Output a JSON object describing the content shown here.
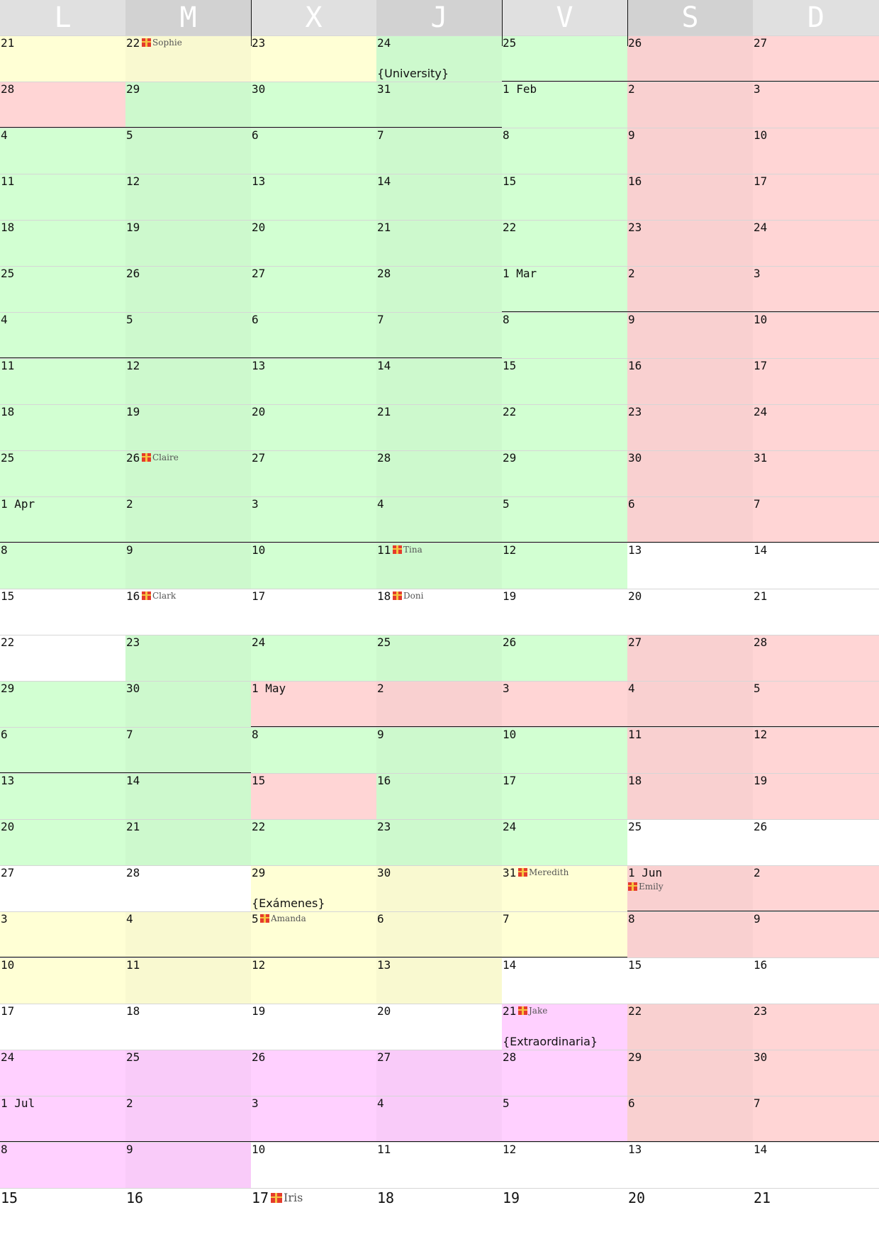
{
  "colors": {
    "header_a": "#e0e0e0",
    "header_b": "#d2d2d2",
    "yellow": "#ffffd5",
    "green": "#d2ffd2",
    "red": "#ffd5d5",
    "pink": "#ffd0ff",
    "white": "#ffffff",
    "rowline": "#d6d6d6",
    "monthline": "#111111"
  },
  "weekdays": [
    "L",
    "M",
    "X",
    "J",
    "V",
    "S",
    "D"
  ],
  "weeks": [
    {
      "days": [
        {
          "label": "21",
          "bg": "yellow"
        },
        {
          "label": "22",
          "bg": "yellow",
          "birthday": "Sophie"
        },
        {
          "label": "23",
          "bg": "yellow"
        },
        {
          "label": "24",
          "bg": "green",
          "event": "{University}"
        },
        {
          "label": "25",
          "bg": "green"
        },
        {
          "label": "26",
          "bg": "red"
        },
        {
          "label": "27",
          "bg": "red"
        }
      ]
    },
    {
      "days": [
        {
          "label": "28",
          "bg": "red"
        },
        {
          "label": "29",
          "bg": "green"
        },
        {
          "label": "30",
          "bg": "green"
        },
        {
          "label": "31",
          "bg": "green"
        },
        {
          "label": "1 Feb",
          "bg": "green"
        },
        {
          "label": "2",
          "bg": "red"
        },
        {
          "label": "3",
          "bg": "red"
        }
      ]
    },
    {
      "days": [
        {
          "label": "4",
          "bg": "green"
        },
        {
          "label": "5",
          "bg": "green"
        },
        {
          "label": "6",
          "bg": "green"
        },
        {
          "label": "7",
          "bg": "green"
        },
        {
          "label": "8",
          "bg": "green"
        },
        {
          "label": "9",
          "bg": "red"
        },
        {
          "label": "10",
          "bg": "red"
        }
      ]
    },
    {
      "days": [
        {
          "label": "11",
          "bg": "green"
        },
        {
          "label": "12",
          "bg": "green"
        },
        {
          "label": "13",
          "bg": "green"
        },
        {
          "label": "14",
          "bg": "green"
        },
        {
          "label": "15",
          "bg": "green"
        },
        {
          "label": "16",
          "bg": "red"
        },
        {
          "label": "17",
          "bg": "red"
        }
      ]
    },
    {
      "days": [
        {
          "label": "18",
          "bg": "green"
        },
        {
          "label": "19",
          "bg": "green"
        },
        {
          "label": "20",
          "bg": "green"
        },
        {
          "label": "21",
          "bg": "green"
        },
        {
          "label": "22",
          "bg": "green"
        },
        {
          "label": "23",
          "bg": "red"
        },
        {
          "label": "24",
          "bg": "red"
        }
      ]
    },
    {
      "days": [
        {
          "label": "25",
          "bg": "green"
        },
        {
          "label": "26",
          "bg": "green"
        },
        {
          "label": "27",
          "bg": "green"
        },
        {
          "label": "28",
          "bg": "green"
        },
        {
          "label": "1 Mar",
          "bg": "green"
        },
        {
          "label": "2",
          "bg": "red"
        },
        {
          "label": "3",
          "bg": "red"
        }
      ]
    },
    {
      "days": [
        {
          "label": "4",
          "bg": "green"
        },
        {
          "label": "5",
          "bg": "green"
        },
        {
          "label": "6",
          "bg": "green"
        },
        {
          "label": "7",
          "bg": "green"
        },
        {
          "label": "8",
          "bg": "green"
        },
        {
          "label": "9",
          "bg": "red"
        },
        {
          "label": "10",
          "bg": "red"
        }
      ]
    },
    {
      "days": [
        {
          "label": "11",
          "bg": "green"
        },
        {
          "label": "12",
          "bg": "green"
        },
        {
          "label": "13",
          "bg": "green"
        },
        {
          "label": "14",
          "bg": "green"
        },
        {
          "label": "15",
          "bg": "green"
        },
        {
          "label": "16",
          "bg": "red"
        },
        {
          "label": "17",
          "bg": "red"
        }
      ]
    },
    {
      "days": [
        {
          "label": "18",
          "bg": "green"
        },
        {
          "label": "19",
          "bg": "green"
        },
        {
          "label": "20",
          "bg": "green"
        },
        {
          "label": "21",
          "bg": "green"
        },
        {
          "label": "22",
          "bg": "green"
        },
        {
          "label": "23",
          "bg": "red"
        },
        {
          "label": "24",
          "bg": "red"
        }
      ]
    },
    {
      "days": [
        {
          "label": "25",
          "bg": "green"
        },
        {
          "label": "26",
          "bg": "green",
          "birthday": "Claire"
        },
        {
          "label": "27",
          "bg": "green"
        },
        {
          "label": "28",
          "bg": "green"
        },
        {
          "label": "29",
          "bg": "green"
        },
        {
          "label": "30",
          "bg": "red"
        },
        {
          "label": "31",
          "bg": "red"
        }
      ]
    },
    {
      "days": [
        {
          "label": "1 Apr",
          "bg": "green"
        },
        {
          "label": "2",
          "bg": "green"
        },
        {
          "label": "3",
          "bg": "green"
        },
        {
          "label": "4",
          "bg": "green"
        },
        {
          "label": "5",
          "bg": "green"
        },
        {
          "label": "6",
          "bg": "red"
        },
        {
          "label": "7",
          "bg": "red"
        }
      ]
    },
    {
      "days": [
        {
          "label": "8",
          "bg": "green"
        },
        {
          "label": "9",
          "bg": "green"
        },
        {
          "label": "10",
          "bg": "green"
        },
        {
          "label": "11",
          "bg": "green",
          "birthday": "Tina"
        },
        {
          "label": "12",
          "bg": "green"
        },
        {
          "label": "13",
          "bg": "white"
        },
        {
          "label": "14",
          "bg": "white"
        }
      ]
    },
    {
      "days": [
        {
          "label": "15",
          "bg": "white"
        },
        {
          "label": "16",
          "bg": "white",
          "birthday": "Clark"
        },
        {
          "label": "17",
          "bg": "white"
        },
        {
          "label": "18",
          "bg": "white",
          "birthday": "Doni"
        },
        {
          "label": "19",
          "bg": "white"
        },
        {
          "label": "20",
          "bg": "white"
        },
        {
          "label": "21",
          "bg": "white"
        }
      ]
    },
    {
      "days": [
        {
          "label": "22",
          "bg": "white"
        },
        {
          "label": "23",
          "bg": "green"
        },
        {
          "label": "24",
          "bg": "green"
        },
        {
          "label": "25",
          "bg": "green"
        },
        {
          "label": "26",
          "bg": "green"
        },
        {
          "label": "27",
          "bg": "red"
        },
        {
          "label": "28",
          "bg": "red"
        }
      ]
    },
    {
      "days": [
        {
          "label": "29",
          "bg": "green"
        },
        {
          "label": "30",
          "bg": "green"
        },
        {
          "label": "1 May",
          "bg": "red"
        },
        {
          "label": "2",
          "bg": "red"
        },
        {
          "label": "3",
          "bg": "red"
        },
        {
          "label": "4",
          "bg": "red"
        },
        {
          "label": "5",
          "bg": "red"
        }
      ]
    },
    {
      "days": [
        {
          "label": "6",
          "bg": "green"
        },
        {
          "label": "7",
          "bg": "green"
        },
        {
          "label": "8",
          "bg": "green"
        },
        {
          "label": "9",
          "bg": "green"
        },
        {
          "label": "10",
          "bg": "green"
        },
        {
          "label": "11",
          "bg": "red"
        },
        {
          "label": "12",
          "bg": "red"
        }
      ]
    },
    {
      "days": [
        {
          "label": "13",
          "bg": "green"
        },
        {
          "label": "14",
          "bg": "green"
        },
        {
          "label": "15",
          "bg": "red"
        },
        {
          "label": "16",
          "bg": "green"
        },
        {
          "label": "17",
          "bg": "green"
        },
        {
          "label": "18",
          "bg": "red"
        },
        {
          "label": "19",
          "bg": "red"
        }
      ]
    },
    {
      "days": [
        {
          "label": "20",
          "bg": "green"
        },
        {
          "label": "21",
          "bg": "green"
        },
        {
          "label": "22",
          "bg": "green"
        },
        {
          "label": "23",
          "bg": "green"
        },
        {
          "label": "24",
          "bg": "green"
        },
        {
          "label": "25",
          "bg": "white"
        },
        {
          "label": "26",
          "bg": "white"
        }
      ]
    },
    {
      "days": [
        {
          "label": "27",
          "bg": "white"
        },
        {
          "label": "28",
          "bg": "white"
        },
        {
          "label": "29",
          "bg": "yellow",
          "event": "{Exámenes}"
        },
        {
          "label": "30",
          "bg": "yellow"
        },
        {
          "label": "31",
          "bg": "yellow",
          "birthday": "Meredith"
        },
        {
          "label": "1 Jun",
          "bg": "red",
          "birthday": "Emily",
          "birthday_below": true
        },
        {
          "label": "2",
          "bg": "red"
        }
      ]
    },
    {
      "days": [
        {
          "label": "3",
          "bg": "yellow"
        },
        {
          "label": "4",
          "bg": "yellow"
        },
        {
          "label": "5",
          "bg": "yellow",
          "birthday": "Amanda"
        },
        {
          "label": "6",
          "bg": "yellow"
        },
        {
          "label": "7",
          "bg": "yellow"
        },
        {
          "label": "8",
          "bg": "red"
        },
        {
          "label": "9",
          "bg": "red"
        }
      ]
    },
    {
      "days": [
        {
          "label": "10",
          "bg": "yellow"
        },
        {
          "label": "11",
          "bg": "yellow"
        },
        {
          "label": "12",
          "bg": "yellow"
        },
        {
          "label": "13",
          "bg": "yellow"
        },
        {
          "label": "14",
          "bg": "white"
        },
        {
          "label": "15",
          "bg": "white"
        },
        {
          "label": "16",
          "bg": "white"
        }
      ]
    },
    {
      "days": [
        {
          "label": "17",
          "bg": "white"
        },
        {
          "label": "18",
          "bg": "white"
        },
        {
          "label": "19",
          "bg": "white"
        },
        {
          "label": "20",
          "bg": "white"
        },
        {
          "label": "21",
          "bg": "pink",
          "birthday": "Jake",
          "event": "{Extraordinaria}"
        },
        {
          "label": "22",
          "bg": "red"
        },
        {
          "label": "23",
          "bg": "red"
        }
      ]
    },
    {
      "days": [
        {
          "label": "24",
          "bg": "pink"
        },
        {
          "label": "25",
          "bg": "pink"
        },
        {
          "label": "26",
          "bg": "pink"
        },
        {
          "label": "27",
          "bg": "pink"
        },
        {
          "label": "28",
          "bg": "pink"
        },
        {
          "label": "29",
          "bg": "red"
        },
        {
          "label": "30",
          "bg": "red"
        }
      ]
    },
    {
      "days": [
        {
          "label": "1 Jul",
          "bg": "pink"
        },
        {
          "label": "2",
          "bg": "pink"
        },
        {
          "label": "3",
          "bg": "pink"
        },
        {
          "label": "4",
          "bg": "pink"
        },
        {
          "label": "5",
          "bg": "pink"
        },
        {
          "label": "6",
          "bg": "red"
        },
        {
          "label": "7",
          "bg": "red"
        }
      ]
    },
    {
      "days": [
        {
          "label": "8",
          "bg": "pink"
        },
        {
          "label": "9",
          "bg": "pink"
        },
        {
          "label": "10",
          "bg": "white"
        },
        {
          "label": "11",
          "bg": "white"
        },
        {
          "label": "12",
          "bg": "white"
        },
        {
          "label": "13",
          "bg": "white"
        },
        {
          "label": "14",
          "bg": "white"
        }
      ]
    },
    {
      "days": [
        {
          "label": "15",
          "bg": "white"
        },
        {
          "label": "16",
          "bg": "white"
        },
        {
          "label": "17",
          "bg": "white",
          "birthday": "Iris"
        },
        {
          "label": "18",
          "bg": "white"
        },
        {
          "label": "19",
          "bg": "white"
        },
        {
          "label": "20",
          "bg": "white"
        },
        {
          "label": "21",
          "bg": "white"
        }
      ]
    }
  ]
}
